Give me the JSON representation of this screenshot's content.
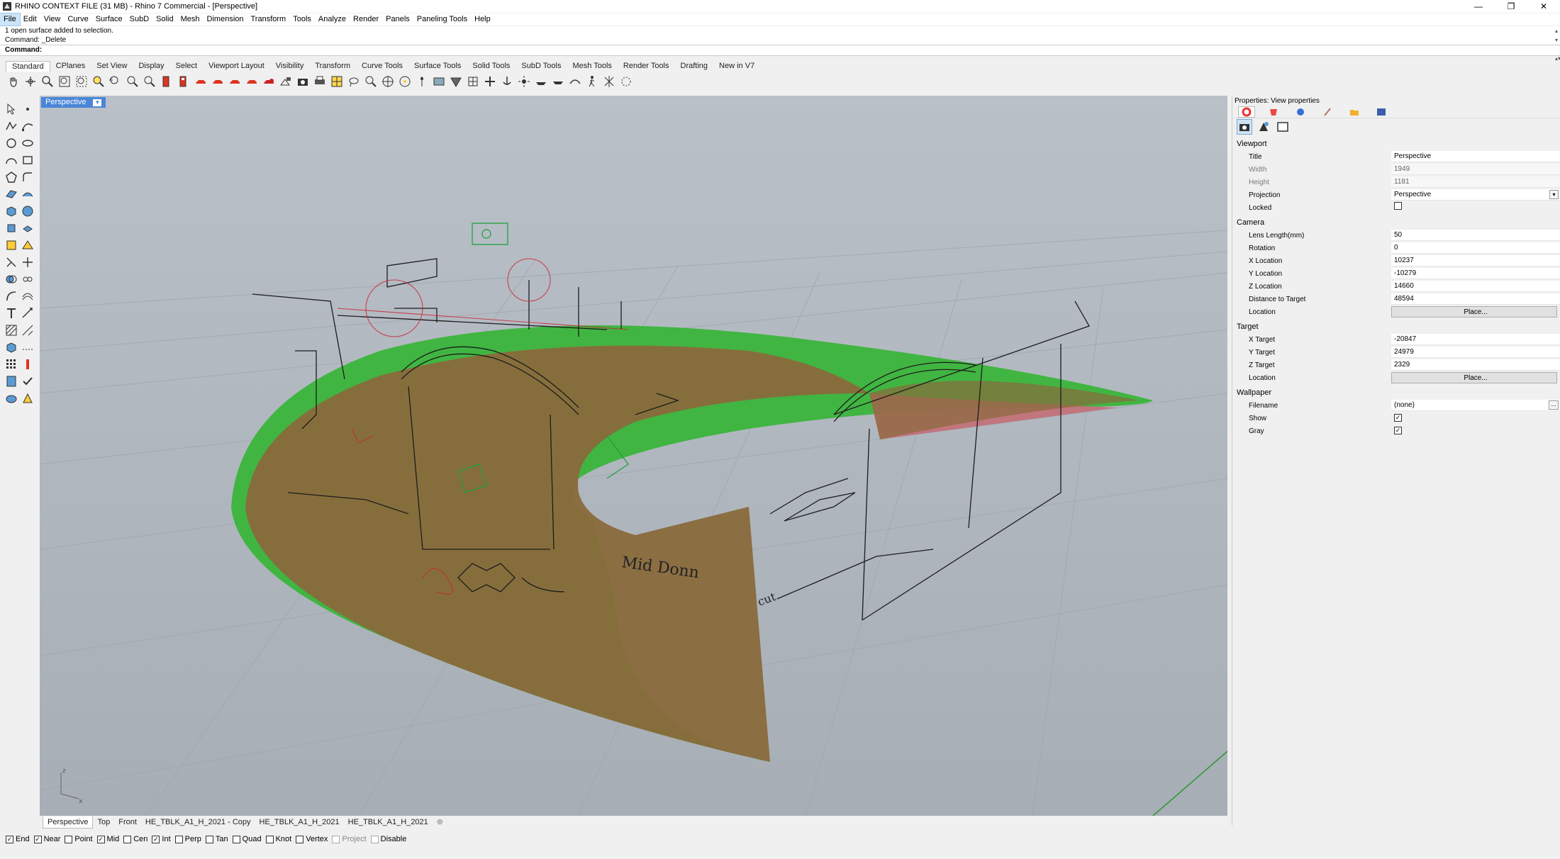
{
  "window": {
    "title": "RHINO CONTEXT FILE (31 MB) - Rhino 7 Commercial - [Perspective]",
    "minimize": "—",
    "restore": "❐",
    "close": "✕"
  },
  "menu": [
    "File",
    "Edit",
    "View",
    "Curve",
    "Surface",
    "SubD",
    "Solid",
    "Mesh",
    "Dimension",
    "Transform",
    "Tools",
    "Analyze",
    "Render",
    "Panels",
    "Paneling Tools",
    "Help"
  ],
  "command_history": [
    "1 open surface added to selection.",
    "Command: _Delete"
  ],
  "command_prompt": "Command:",
  "toolbar_tabs": [
    "Standard",
    "CPlanes",
    "Set View",
    "Display",
    "Select",
    "Viewport Layout",
    "Visibility",
    "Transform",
    "Curve Tools",
    "Surface Tools",
    "Solid Tools",
    "SubD Tools",
    "Mesh Tools",
    "Render Tools",
    "Drafting",
    "New in V7"
  ],
  "viewport": {
    "active_label": "Perspective",
    "annotation": "Mid Donn",
    "annotation2": "cut"
  },
  "viewport_tabs": [
    "Perspective",
    "Top",
    "Front",
    "HE_TBLK_A1_H_2021 - Copy",
    "HE_TBLK_A1_H_2021",
    "HE_TBLK_A1_H_2021"
  ],
  "viewport_tab_add": "⊕",
  "osnaps": [
    {
      "label": "End",
      "checked": true
    },
    {
      "label": "Near",
      "checked": true
    },
    {
      "label": "Point",
      "checked": false
    },
    {
      "label": "Mid",
      "checked": true
    },
    {
      "label": "Cen",
      "checked": false
    },
    {
      "label": "Int",
      "checked": true
    },
    {
      "label": "Perp",
      "checked": false
    },
    {
      "label": "Tan",
      "checked": false
    },
    {
      "label": "Quad",
      "checked": false
    },
    {
      "label": "Knot",
      "checked": false
    },
    {
      "label": "Vertex",
      "checked": false
    },
    {
      "label": "Project",
      "checked": false
    },
    {
      "label": "Disable",
      "checked": false
    }
  ],
  "properties": {
    "title": "Properties: View properties",
    "sections": {
      "viewport": "Viewport",
      "camera": "Camera",
      "target": "Target",
      "wallpaper": "Wallpaper"
    },
    "vp_title_label": "Title",
    "vp_title": "Perspective",
    "vp_width_label": "Width",
    "vp_width": "1949",
    "vp_height_label": "Height",
    "vp_height": "1181",
    "vp_proj_label": "Projection",
    "vp_proj": "Perspective",
    "vp_locked_label": "Locked",
    "cam_lens_label": "Lens Length(mm)",
    "cam_lens": "50",
    "cam_rot_label": "Rotation",
    "cam_rot": "0",
    "cam_x_label": "X Location",
    "cam_x": "10237",
    "cam_y_label": "Y Location",
    "cam_y": "-10279",
    "cam_z_label": "Z Location",
    "cam_z": "14660",
    "cam_dist_label": "Distance to Target",
    "cam_dist": "48594",
    "cam_loc_label": "Location",
    "cam_loc_btn": "Place...",
    "tgt_x_label": "X Target",
    "tgt_x": "-20847",
    "tgt_y_label": "Y Target",
    "tgt_y": "24979",
    "tgt_z_label": "Z Target",
    "tgt_z": "2329",
    "tgt_loc_label": "Location",
    "tgt_loc_btn": "Place...",
    "wp_file_label": "Filename",
    "wp_file": "(none)",
    "wp_show_label": "Show",
    "wp_gray_label": "Gray"
  }
}
